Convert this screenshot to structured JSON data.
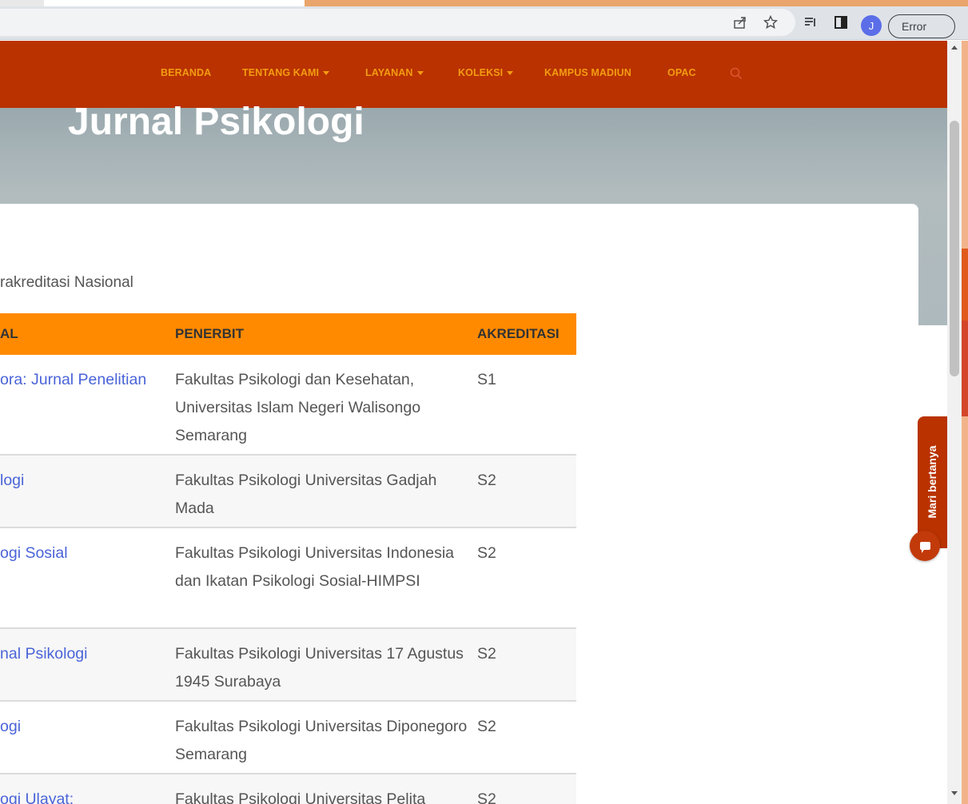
{
  "browser": {
    "icons": [
      "share-icon",
      "bookmark-star-icon",
      "reading-list-icon",
      "side-panel-icon"
    ],
    "profile_initial": "J",
    "error_label": "Error"
  },
  "nav": {
    "items": [
      {
        "label": "BERANDA",
        "dropdown": false
      },
      {
        "label": "TENTANG KAMI",
        "dropdown": true
      },
      {
        "label": "LAYANAN",
        "dropdown": true
      },
      {
        "label": "KOLEKSI",
        "dropdown": true
      },
      {
        "label": "KAMPUS MADIUN",
        "dropdown": false
      },
      {
        "label": "OPAC",
        "dropdown": false
      }
    ]
  },
  "hero": {
    "title": "Jurnal Psikologi"
  },
  "content": {
    "subheading": "rakreditasi Nasional",
    "table": {
      "headers": [
        "AL",
        "PENERBIT",
        "AKREDITASI"
      ],
      "rows": [
        {
          "name": "ora: Jurnal Penelitian",
          "publisher": "Fakultas Psikologi dan Kesehatan, Universitas Islam Negeri Walisongo Semarang",
          "accreditation": "S1"
        },
        {
          "name": "logi",
          "publisher": "Fakultas Psikologi Universitas Gadjah Mada",
          "accreditation": "S2"
        },
        {
          "name": "ogi Sosial",
          "publisher": "Fakultas Psikologi Universitas Indonesia dan Ikatan Psikologi Sosial-HIMPSI",
          "accreditation": "S2"
        },
        {
          "name": "nal Psikologi",
          "publisher": "Fakultas Psikologi Universitas 17 Agustus 1945 Surabaya",
          "accreditation": "S2"
        },
        {
          "name": "ogi",
          "publisher": "Fakultas Psikologi Universitas Diponegoro Semarang",
          "accreditation": "S2"
        },
        {
          "name": "ogi Ulayat:",
          "publisher": "Fakultas Psikologi Universitas Pelita",
          "accreditation": "S2"
        }
      ]
    }
  },
  "chat": {
    "label": "Mari bertanya"
  },
  "colors": {
    "nav_bg": "#b93200",
    "nav_text": "#f39c12",
    "table_header": "#ff8a00",
    "link": "#4a64d8"
  }
}
